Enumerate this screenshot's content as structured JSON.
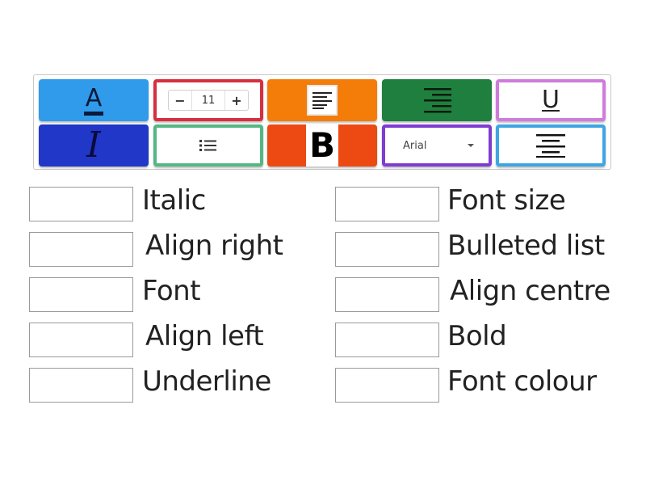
{
  "tray": {
    "tiles": [
      {
        "id": "font-colour",
        "glyph": "A",
        "bg": "#2f9bea"
      },
      {
        "id": "font-size",
        "minus": "−",
        "value": "11",
        "plus": "+",
        "border": "#d62f40"
      },
      {
        "id": "align-left",
        "bg": "#f47d0a"
      },
      {
        "id": "align-right",
        "bg": "#1f7f3f"
      },
      {
        "id": "underline",
        "glyph": "U",
        "border": "#cf7bdc"
      },
      {
        "id": "italic",
        "glyph": "I",
        "bg": "#2137c8"
      },
      {
        "id": "bulleted-list",
        "glyph": "☰",
        "border": "#55b783"
      },
      {
        "id": "bold",
        "glyph": "B",
        "bg": "#ec4a12"
      },
      {
        "id": "font",
        "selected": "Arial",
        "border": "#7f3cd2"
      },
      {
        "id": "align-centre",
        "border": "#3ea6e3"
      }
    ]
  },
  "targets": {
    "left": [
      "Italic",
      "Align right",
      "Font",
      "Align left",
      "Underline"
    ],
    "right": [
      "Font size",
      "Bulleted list",
      "Align centre",
      "Bold",
      "Font colour"
    ]
  }
}
